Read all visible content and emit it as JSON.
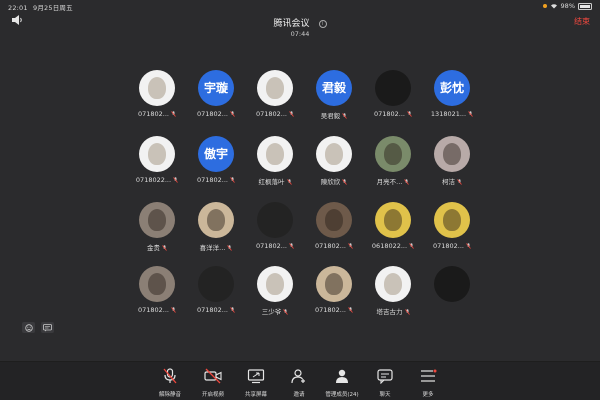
{
  "statusbar": {
    "time": "22:01",
    "date": "9月25日周五",
    "battery": "98%"
  },
  "header": {
    "title": "腾讯会议",
    "elapsed": "07:44",
    "end_label": "结束"
  },
  "participants": [
    {
      "name": "071802...",
      "avatar": "white",
      "avatar_text": ""
    },
    {
      "name": "071802...",
      "avatar": "text",
      "avatar_text": "宇璇"
    },
    {
      "name": "071802...",
      "avatar": "white",
      "avatar_text": ""
    },
    {
      "name": "吴君毅",
      "avatar": "text",
      "avatar_text": "君毅"
    },
    {
      "name": "071802...",
      "avatar": "dark",
      "avatar_text": ""
    },
    {
      "name": "1318021...",
      "avatar": "text",
      "avatar_text": "彭忱"
    },
    {
      "name": "0718022...",
      "avatar": "white",
      "avatar_text": ""
    },
    {
      "name": "071802...",
      "avatar": "text",
      "avatar_text": "傲宇"
    },
    {
      "name": "红枫落叶",
      "avatar": "white",
      "avatar_text": ""
    },
    {
      "name": "陳欣欣",
      "avatar": "white",
      "avatar_text": ""
    },
    {
      "name": "月亮不...",
      "avatar": "green",
      "avatar_text": ""
    },
    {
      "name": "柯洁",
      "avatar": "pinkgray",
      "avatar_text": ""
    },
    {
      "name": "金贵",
      "avatar": "gray",
      "avatar_text": ""
    },
    {
      "name": "喜洋洋...",
      "avatar": "tan",
      "avatar_text": ""
    },
    {
      "name": "071802...",
      "avatar": "night",
      "avatar_text": ""
    },
    {
      "name": "071802...",
      "avatar": "brown",
      "avatar_text": ""
    },
    {
      "name": "0618022...",
      "avatar": "yellow",
      "avatar_text": ""
    },
    {
      "name": "071802...",
      "avatar": "yellow",
      "avatar_text": ""
    },
    {
      "name": "071802...",
      "avatar": "gray",
      "avatar_text": ""
    },
    {
      "name": "071802...",
      "avatar": "night",
      "avatar_text": ""
    },
    {
      "name": "三少爷",
      "avatar": "white",
      "avatar_text": ""
    },
    {
      "name": "071802...",
      "avatar": "tan",
      "avatar_text": ""
    },
    {
      "name": "塔吉古力",
      "avatar": "white",
      "avatar_text": ""
    },
    {
      "name": "",
      "avatar": "dark",
      "avatar_text": ""
    }
  ],
  "toolbar": {
    "unmute": "解除静音",
    "video": "开启视频",
    "share": "共享屏幕",
    "invite": "邀请",
    "members": "管理成员(24)",
    "chat": "聊天",
    "more": "更多"
  },
  "colors": {
    "accent": "#2d6de0",
    "end": "#f0483e",
    "background": "#2b2b2d",
    "toolbar": "#232325"
  }
}
